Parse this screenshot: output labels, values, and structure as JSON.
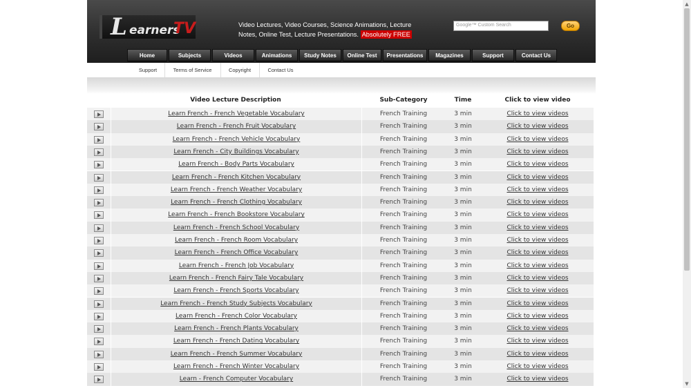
{
  "header": {
    "logo": {
      "first": "L",
      "rest": "earners",
      "tv": "TV"
    },
    "tagline_line1": "Video Lectures, Video Courses, Science Animations, Lecture",
    "tagline_line2": "Notes, Online Test, Lecture Presentations.",
    "tagline_free": "Absolutely FREE",
    "search_placeholder": "Google™ Custom Search",
    "go_label": "Go"
  },
  "nav": [
    "Home",
    "Subjects",
    "Videos",
    "Animations",
    "Study Notes",
    "Online Test",
    "Presentations",
    "Magazines",
    "Support",
    "Contact Us"
  ],
  "subnav": [
    "Support",
    "Terms of Service",
    "Copyright",
    "Contact Us"
  ],
  "table": {
    "headers": [
      "Video Lecture Description",
      "Sub-Category",
      "Time",
      "Click to view video"
    ],
    "rows": [
      {
        "desc": "Learn French - French Vegetable Vocabulary",
        "sub": "French Training",
        "time": "3 min",
        "view": "Click to view videos"
      },
      {
        "desc": "Learn French - French Fruit Vocabulary",
        "sub": "French Training",
        "time": "3 min",
        "view": "Click to view videos"
      },
      {
        "desc": "Learn French - French Vehicle Vocabulary",
        "sub": "French Training",
        "time": "3 min",
        "view": "Click to view videos"
      },
      {
        "desc": "Learn French - City Buildings Vocabulary",
        "sub": "French Training",
        "time": "3 min",
        "view": "Click to view videos"
      },
      {
        "desc": "Learn French - Body Parts Vocabulary",
        "sub": "French Training",
        "time": "3 min",
        "view": "Click to view videos"
      },
      {
        "desc": "Learn French - French Kitchen Vocabulary",
        "sub": "French Training",
        "time": "3 min",
        "view": "Click to view videos"
      },
      {
        "desc": "Learn French - French Weather Vocabulary",
        "sub": "French Training",
        "time": "3 min",
        "view": "Click to view videos"
      },
      {
        "desc": "Learn French - French Clothing Vocabulary",
        "sub": "French Training",
        "time": "3 min",
        "view": "Click to view videos"
      },
      {
        "desc": "Learn French - French Bookstore Vocabulary",
        "sub": "French Training",
        "time": "3 min",
        "view": "Click to view videos"
      },
      {
        "desc": "Learn French - French School Vocabulary",
        "sub": "French Training",
        "time": "3 min",
        "view": "Click to view videos"
      },
      {
        "desc": "Learn French - French Room Vocabulary",
        "sub": "French Training",
        "time": "3 min",
        "view": "Click to view videos"
      },
      {
        "desc": "Learn French - French Office Vocabulary",
        "sub": "French Training",
        "time": "3 min",
        "view": "Click to view videos"
      },
      {
        "desc": "Learn French - French Job Vocabulary",
        "sub": "French Training",
        "time": "3 min",
        "view": "Click to view videos"
      },
      {
        "desc": "Learn French - French Fairy Tale Vocabulary",
        "sub": "French Training",
        "time": "3 min",
        "view": "Click to view videos"
      },
      {
        "desc": "Learn French - French Sports Vocabulary",
        "sub": "French Training",
        "time": "3 min",
        "view": "Click to view videos"
      },
      {
        "desc": "Learn French - French Study Subjects Vocabulary",
        "sub": "French Training",
        "time": "3 min",
        "view": "Click to view videos"
      },
      {
        "desc": "Learn French - French Color Vocabulary",
        "sub": "French Training",
        "time": "3 min",
        "view": "Click to view videos"
      },
      {
        "desc": "Learn French - French Plants Vocabulary",
        "sub": "French Training",
        "time": "3 min",
        "view": "Click to view videos"
      },
      {
        "desc": "Learn French - French Dating Vocabulary",
        "sub": "French Training",
        "time": "3 min",
        "view": "Click to view videos"
      },
      {
        "desc": "Learn French - French Summer Vocabulary",
        "sub": "French Training",
        "time": "3 min",
        "view": "Click to view videos"
      },
      {
        "desc": "Learn French - French Winter Vocabulary",
        "sub": "French Training",
        "time": "3 min",
        "view": "Click to view videos"
      },
      {
        "desc": "Learn - French Computer Vocabulary",
        "sub": "French Training",
        "time": "3 min",
        "view": "Click to view videos"
      }
    ]
  },
  "icons": {
    "play": "play-icon",
    "scroll_up": "arrow-up-icon",
    "scroll_down": "arrow-down-icon"
  }
}
